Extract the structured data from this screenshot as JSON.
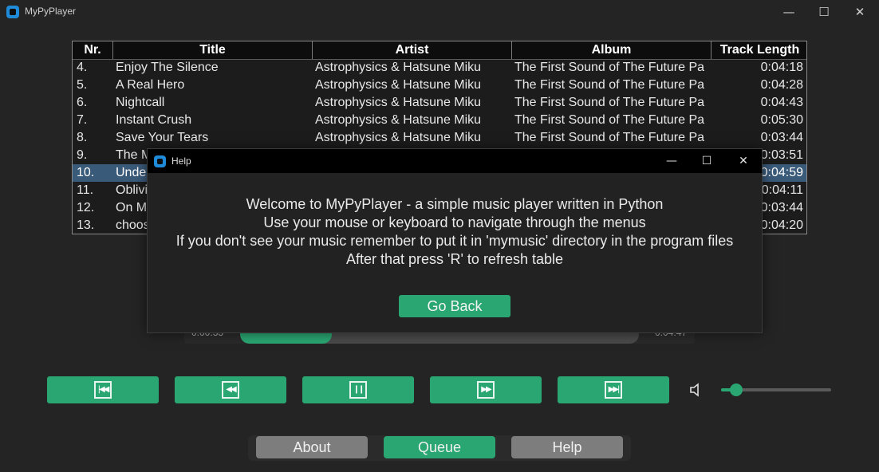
{
  "window": {
    "title": "MyPyPlayer",
    "minimize_glyph": "—",
    "maximize_glyph": "☐",
    "close_glyph": "✕"
  },
  "table": {
    "columns": [
      "Nr.",
      "Title",
      "Artist",
      "Album",
      "Track Length"
    ],
    "rows": [
      {
        "nr": "4.",
        "title": "Enjoy The Silence",
        "artist": "Astrophysics & Hatsune Miku",
        "album": "The First Sound of The Future Pa",
        "length": "0:04:18"
      },
      {
        "nr": "5.",
        "title": "A Real Hero",
        "artist": "Astrophysics & Hatsune Miku",
        "album": "The First Sound of The Future Pa",
        "length": "0:04:28"
      },
      {
        "nr": "6.",
        "title": "Nightcall",
        "artist": "Astrophysics & Hatsune Miku",
        "album": "The First Sound of The Future Pa",
        "length": "0:04:43"
      },
      {
        "nr": "7.",
        "title": "Instant Crush",
        "artist": "Astrophysics & Hatsune Miku",
        "album": "The First Sound of The Future Pa",
        "length": "0:05:30"
      },
      {
        "nr": "8.",
        "title": "Save Your Tears",
        "artist": "Astrophysics & Hatsune Miku",
        "album": "The First Sound of The Future Pa",
        "length": "0:03:44"
      },
      {
        "nr": "9.",
        "title": "The M",
        "artist": "",
        "album": "",
        "length": "0:03:51"
      },
      {
        "nr": "10.",
        "title": "Unde",
        "artist": "",
        "album": "",
        "length": "0:04:59"
      },
      {
        "nr": "11.",
        "title": "Oblivi",
        "artist": "",
        "album": "",
        "length": "0:04:11"
      },
      {
        "nr": "12.",
        "title": "On M",
        "artist": "",
        "album": "",
        "length": "0:03:44"
      },
      {
        "nr": "13.",
        "title": "choos",
        "artist": "",
        "album": "",
        "length": "0:04:20"
      }
    ],
    "selected_row_index": 6
  },
  "player": {
    "elapsed": "0:00:33",
    "total": "0:04:47",
    "progress_fraction": 0.23,
    "volume_fraction": 0.14
  },
  "controls": {
    "skip_back_glyph": "|◀◀",
    "rewind_glyph": "◀◀",
    "pause_glyph": "❙❙",
    "fast_forward_glyph": "▶▶",
    "skip_forward_glyph": "▶▶|"
  },
  "nav": {
    "about": "About",
    "queue": "Queue",
    "help": "Help"
  },
  "help_dialog": {
    "title": "Help",
    "lines": [
      "Welcome to MyPyPlayer - a simple music player written in Python",
      "Use your mouse or keyboard to navigate through the menus",
      "If you don't see your music remember to put it in 'mymusic' directory in the program files",
      "After that press 'R' to refresh table"
    ],
    "go_back_label": "Go Back"
  },
  "colors": {
    "accent": "#2aa672",
    "selected_row": "#3a5a7a",
    "gray_button": "#7d7d7d",
    "background": "#242424"
  }
}
